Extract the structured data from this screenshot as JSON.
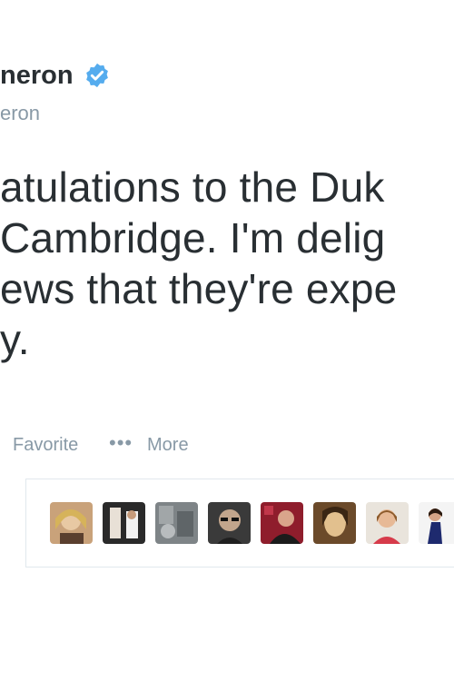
{
  "tweet": {
    "name": "neron",
    "handle": "eron",
    "text_lines": [
      "atulations to the Duk",
      "Cambridge. I'm delig",
      "ews that they're expe",
      "y."
    ]
  },
  "actions": {
    "favorite_label": "Favorite",
    "more_dots": "•••",
    "more_label": "More"
  },
  "colors": {
    "text": "#292f33",
    "muted": "#8899a6",
    "verified_badge": "#55acee",
    "border": "#e1e8ed"
  },
  "icons": {
    "verified": "verified-badge-icon",
    "more": "more-dots-icon"
  },
  "avatars": [
    {
      "name": "favoriter-avatar-1"
    },
    {
      "name": "favoriter-avatar-2"
    },
    {
      "name": "favoriter-avatar-3"
    },
    {
      "name": "favoriter-avatar-4"
    },
    {
      "name": "favoriter-avatar-5"
    },
    {
      "name": "favoriter-avatar-6"
    },
    {
      "name": "favoriter-avatar-7"
    },
    {
      "name": "favoriter-avatar-8"
    }
  ]
}
